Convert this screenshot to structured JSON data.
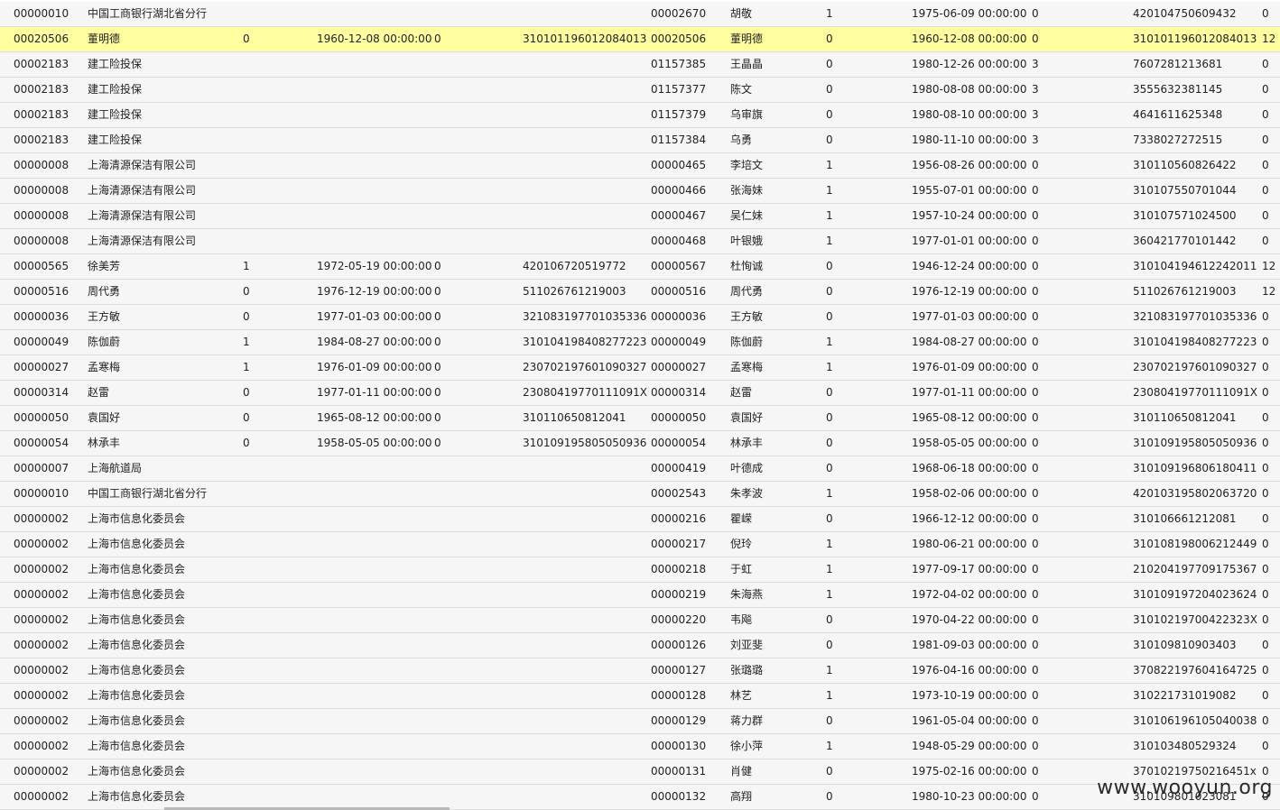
{
  "rows": [
    {
      "selected": false,
      "cells": [
        "00000010",
        "中国工商银行湖北省分行",
        "",
        "",
        "",
        "",
        "00002670",
        "胡敬",
        "1",
        "1975-06-09 00:00:00",
        "0",
        "420104750609432",
        "0"
      ]
    },
    {
      "selected": true,
      "cells": [
        "00020506",
        "董明德",
        "0",
        "1960-12-08 00:00:00",
        "0",
        "310101196012084013",
        "00020506",
        "董明德",
        "0",
        "1960-12-08 00:00:00",
        "0",
        "310101196012084013",
        "12"
      ]
    },
    {
      "selected": false,
      "cells": [
        "00002183",
        "建工险投保",
        "",
        "",
        "",
        "",
        "01157385",
        "王晶晶",
        "0",
        "1980-12-26 00:00:00",
        "3",
        "7607281213681",
        "0"
      ]
    },
    {
      "selected": false,
      "cells": [
        "00002183",
        "建工险投保",
        "",
        "",
        "",
        "",
        "01157377",
        "陈文",
        "0",
        "1980-08-08 00:00:00",
        "3",
        "3555632381145",
        "0"
      ]
    },
    {
      "selected": false,
      "cells": [
        "00002183",
        "建工险投保",
        "",
        "",
        "",
        "",
        "01157379",
        "乌审旗",
        "0",
        "1980-08-10 00:00:00",
        "3",
        "4641611625348",
        "0"
      ]
    },
    {
      "selected": false,
      "cells": [
        "00002183",
        "建工险投保",
        "",
        "",
        "",
        "",
        "01157384",
        "乌勇",
        "0",
        "1980-11-10 00:00:00",
        "3",
        "7338027272515",
        "0"
      ]
    },
    {
      "selected": false,
      "cells": [
        "00000008",
        "上海清源保洁有限公司",
        "",
        "",
        "",
        "",
        "00000465",
        "李培文",
        "1",
        "1956-08-26 00:00:00",
        "0",
        "310110560826422",
        "0"
      ]
    },
    {
      "selected": false,
      "cells": [
        "00000008",
        "上海清源保洁有限公司",
        "",
        "",
        "",
        "",
        "00000466",
        "张海妹",
        "1",
        "1955-07-01 00:00:00",
        "0",
        "310107550701044",
        "0"
      ]
    },
    {
      "selected": false,
      "cells": [
        "00000008",
        "上海清源保洁有限公司",
        "",
        "",
        "",
        "",
        "00000467",
        "吴仁妹",
        "1",
        "1957-10-24 00:00:00",
        "0",
        "310107571024500",
        "0"
      ]
    },
    {
      "selected": false,
      "cells": [
        "00000008",
        "上海清源保洁有限公司",
        "",
        "",
        "",
        "",
        "00000468",
        "叶银娥",
        "1",
        "1977-01-01 00:00:00",
        "0",
        "360421770101442",
        "0"
      ]
    },
    {
      "selected": false,
      "cells": [
        "00000565",
        "徐美芳",
        "1",
        "1972-05-19 00:00:00",
        "0",
        "420106720519772",
        "00000567",
        "杜恂诚",
        "0",
        "1946-12-24 00:00:00",
        "0",
        "310104194612242011",
        "12"
      ]
    },
    {
      "selected": false,
      "cells": [
        "00000516",
        "周代勇",
        "0",
        "1976-12-19 00:00:00",
        "0",
        "511026761219003",
        "00000516",
        "周代勇",
        "0",
        "1976-12-19 00:00:00",
        "0",
        "511026761219003",
        "12"
      ]
    },
    {
      "selected": false,
      "cells": [
        "00000036",
        "王方敏",
        "0",
        "1977-01-03 00:00:00",
        "0",
        "321083197701035336",
        "00000036",
        "王方敏",
        "0",
        "1977-01-03 00:00:00",
        "0",
        "321083197701035336",
        "0"
      ]
    },
    {
      "selected": false,
      "cells": [
        "00000049",
        "陈伽蔚",
        "1",
        "1984-08-27 00:00:00",
        "0",
        "310104198408277223",
        "00000049",
        "陈伽蔚",
        "1",
        "1984-08-27 00:00:00",
        "0",
        "310104198408277223",
        "0"
      ]
    },
    {
      "selected": false,
      "cells": [
        "00000027",
        "孟寒梅",
        "1",
        "1976-01-09 00:00:00",
        "0",
        "230702197601090327",
        "00000027",
        "孟寒梅",
        "1",
        "1976-01-09 00:00:00",
        "0",
        "230702197601090327",
        "0"
      ]
    },
    {
      "selected": false,
      "cells": [
        "00000314",
        "赵雷",
        "0",
        "1977-01-11 00:00:00",
        "0",
        "23080419770111091X",
        "00000314",
        "赵雷",
        "0",
        "1977-01-11 00:00:00",
        "0",
        "23080419770111091X",
        "0"
      ]
    },
    {
      "selected": false,
      "cells": [
        "00000050",
        "袁国好",
        "0",
        "1965-08-12 00:00:00",
        "0",
        "310110650812041",
        "00000050",
        "袁国好",
        "0",
        "1965-08-12 00:00:00",
        "0",
        "310110650812041",
        "0"
      ]
    },
    {
      "selected": false,
      "cells": [
        "00000054",
        "林承丰",
        "0",
        "1958-05-05 00:00:00",
        "0",
        "310109195805050936",
        "00000054",
        "林承丰",
        "0",
        "1958-05-05 00:00:00",
        "0",
        "310109195805050936",
        "0"
      ]
    },
    {
      "selected": false,
      "cells": [
        "00000007",
        "上海航道局",
        "",
        "",
        "",
        "",
        "00000419",
        "叶德成",
        "0",
        "1968-06-18 00:00:00",
        "0",
        "310109196806180411",
        "0"
      ]
    },
    {
      "selected": false,
      "cells": [
        "00000010",
        "中国工商银行湖北省分行",
        "",
        "",
        "",
        "",
        "00002543",
        "朱孝波",
        "1",
        "1958-02-06 00:00:00",
        "0",
        "420103195802063720",
        "0"
      ]
    },
    {
      "selected": false,
      "cells": [
        "00000002",
        "上海市信息化委员会",
        "",
        "",
        "",
        "",
        "00000216",
        "瞿嵘",
        "0",
        "1966-12-12 00:00:00",
        "0",
        "310106661212081",
        "0"
      ]
    },
    {
      "selected": false,
      "cells": [
        "00000002",
        "上海市信息化委员会",
        "",
        "",
        "",
        "",
        "00000217",
        "倪玲",
        "1",
        "1980-06-21 00:00:00",
        "0",
        "310108198006212449",
        "0"
      ]
    },
    {
      "selected": false,
      "cells": [
        "00000002",
        "上海市信息化委员会",
        "",
        "",
        "",
        "",
        "00000218",
        "于虹",
        "1",
        "1977-09-17 00:00:00",
        "0",
        "210204197709175367",
        "0"
      ]
    },
    {
      "selected": false,
      "cells": [
        "00000002",
        "上海市信息化委员会",
        "",
        "",
        "",
        "",
        "00000219",
        "朱海燕",
        "1",
        "1972-04-02 00:00:00",
        "0",
        "310109197204023624",
        "0"
      ]
    },
    {
      "selected": false,
      "cells": [
        "00000002",
        "上海市信息化委员会",
        "",
        "",
        "",
        "",
        "00000220",
        "韦飚",
        "0",
        "1970-04-22 00:00:00",
        "0",
        "31010219700422323X",
        "0"
      ]
    },
    {
      "selected": false,
      "cells": [
        "00000002",
        "上海市信息化委员会",
        "",
        "",
        "",
        "",
        "00000126",
        "刘亚斐",
        "0",
        "1981-09-03 00:00:00",
        "0",
        "310109810903403",
        "0"
      ]
    },
    {
      "selected": false,
      "cells": [
        "00000002",
        "上海市信息化委员会",
        "",
        "",
        "",
        "",
        "00000127",
        "张璐璐",
        "1",
        "1976-04-16 00:00:00",
        "0",
        "370822197604164725",
        "0"
      ]
    },
    {
      "selected": false,
      "cells": [
        "00000002",
        "上海市信息化委员会",
        "",
        "",
        "",
        "",
        "00000128",
        "林艺",
        "1",
        "1973-10-19 00:00:00",
        "0",
        "310221731019082",
        "0"
      ]
    },
    {
      "selected": false,
      "cells": [
        "00000002",
        "上海市信息化委员会",
        "",
        "",
        "",
        "",
        "00000129",
        "蒋力群",
        "0",
        "1961-05-04 00:00:00",
        "0",
        "310106196105040038",
        "0"
      ]
    },
    {
      "selected": false,
      "cells": [
        "00000002",
        "上海市信息化委员会",
        "",
        "",
        "",
        "",
        "00000130",
        "徐小萍",
        "1",
        "1948-05-29 00:00:00",
        "0",
        "310103480529324",
        "0"
      ]
    },
    {
      "selected": false,
      "cells": [
        "00000002",
        "上海市信息化委员会",
        "",
        "",
        "",
        "",
        "00000131",
        "肖健",
        "0",
        "1975-02-16 00:00:00",
        "0",
        "37010219750216451x",
        "0"
      ]
    },
    {
      "selected": false,
      "cells": [
        "00000002",
        "上海市信息化委员会",
        "",
        "",
        "",
        "",
        "00000132",
        "高翔",
        "0",
        "1980-10-23 00:00:00",
        "0",
        "310109801023081",
        "0"
      ]
    }
  ],
  "watermark": "www.wooyun.org",
  "colors": {
    "row_bg": "#f6f6f6",
    "selected_bg": "#ffffa0",
    "gridline": "#dcdcdc"
  }
}
